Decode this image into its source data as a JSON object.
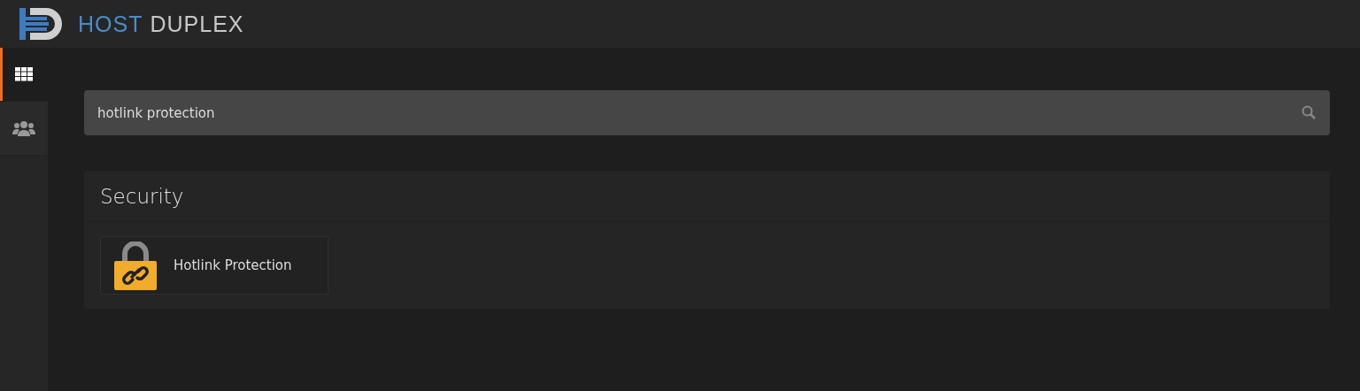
{
  "brand": {
    "first": "HOST",
    "second": "DUPLEX"
  },
  "sidebar": {
    "items": [
      {
        "kind": "grid",
        "selected": true
      },
      {
        "kind": "users",
        "selected": false
      }
    ]
  },
  "search": {
    "value": "hotlink protection"
  },
  "sections": [
    {
      "title": "Security",
      "items": [
        {
          "label": "Hotlink Protection"
        }
      ]
    }
  ]
}
